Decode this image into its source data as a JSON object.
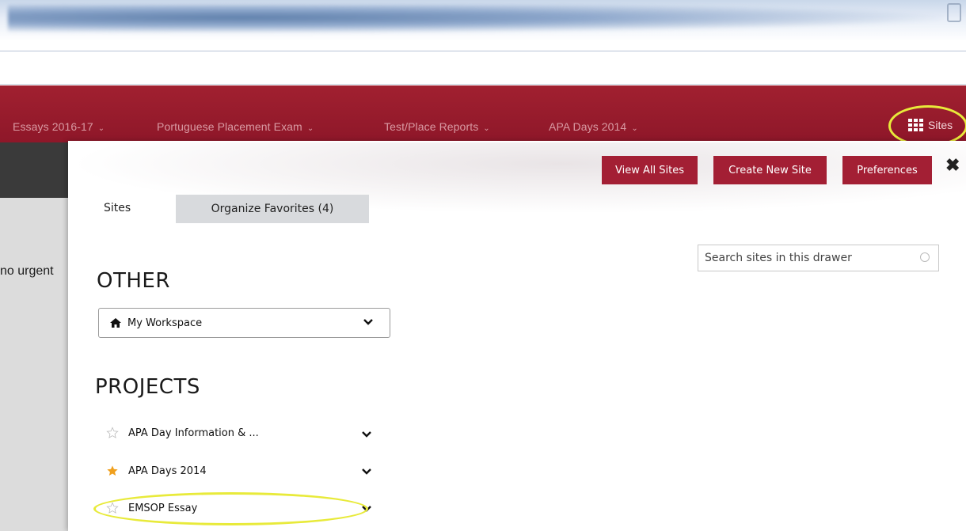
{
  "nav": {
    "items": [
      {
        "label": "Essays 2016-17"
      },
      {
        "label": "Portuguese Placement Exam"
      },
      {
        "label": "Test/Place Reports"
      },
      {
        "label": "APA Days 2014"
      }
    ],
    "sites_label": "Sites"
  },
  "side": {
    "text": "no urgent"
  },
  "drawer": {
    "buttons": {
      "view_all": "View All Sites",
      "create_new": "Create New Site",
      "preferences": "Preferences"
    },
    "tabs": {
      "sites": "Sites",
      "organize_favorites": "Organize Favorites (4)"
    },
    "search": {
      "placeholder": "Search sites in this drawer"
    },
    "other": {
      "heading": "OTHER",
      "workspace_label": "My Workspace"
    },
    "projects": {
      "heading": "PROJECTS",
      "items": [
        {
          "label": "APA Day Information & ...",
          "favorite": false
        },
        {
          "label": "APA Days 2014",
          "favorite": true
        },
        {
          "label": "EMSOP Essay",
          "favorite": false
        }
      ]
    }
  },
  "colors": {
    "nav_red": "#8e1729",
    "button_red": "#a31f34",
    "highlight_yellow": "#e8ea3a",
    "star_gold": "#f0a01e"
  }
}
